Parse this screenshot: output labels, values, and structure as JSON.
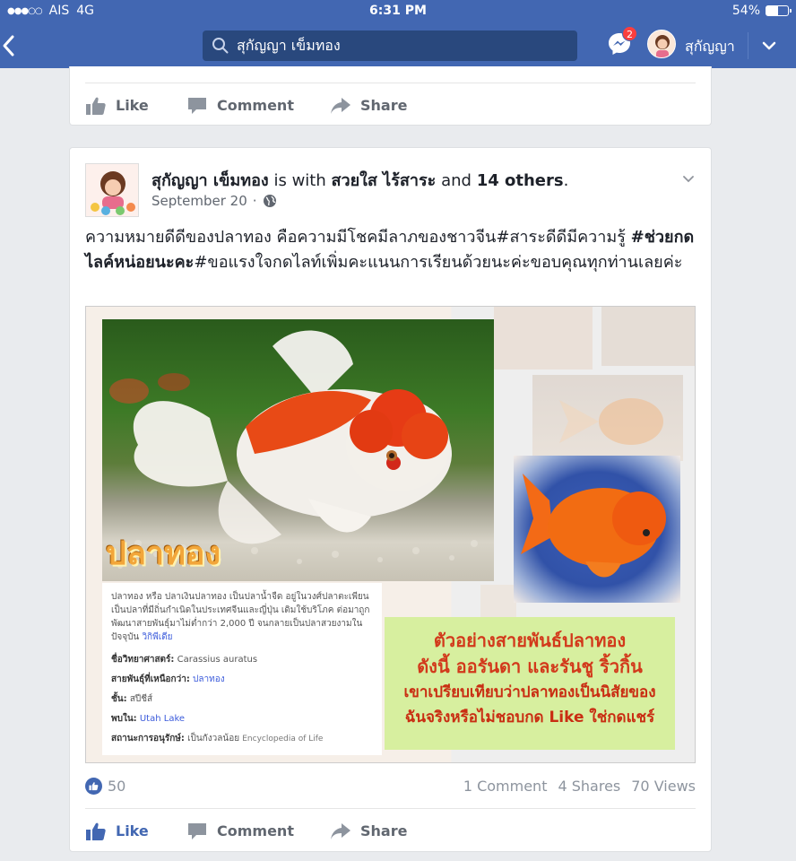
{
  "status_bar": {
    "carrier": "AIS",
    "network": "4G",
    "time": "6:31 PM",
    "battery": "54%",
    "battery_level": 0.54
  },
  "nav": {
    "search_text": "สุกัญญา เข็มทอง",
    "messenger_badge": "2",
    "user_name": "สุกัญญา"
  },
  "top_actions": {
    "like": "Like",
    "comment": "Comment",
    "share": "Share"
  },
  "post": {
    "author": "สุกัญญา เข็มทอง",
    "with_word": "is with",
    "tagged": "สวยใส ไร้สาระ",
    "and_word": "and",
    "others": "14 others",
    "period": ".",
    "date": "September 20",
    "dot": "·",
    "text_part1": "ความหมายดีดีของปลาทอง คือความมีโชคมีลาภของชาวจีน#สาระดีดีมีความรู้ ",
    "text_bold": "#ช่วยกดไลค์หน่อยนะคะ",
    "text_part2": "#ขอแรงใจกดไลท์เพิ่มคะแนนการเรียนด้วยนะค่ะขอบคุณทุกท่านเลยค่ะ",
    "image": {
      "title_overlay": "ปลาทอง",
      "wiki_desc": "ปลาทอง หรือ ปลาเงินปลาทอง เป็นปลาน้ำจืด อยู่ในวงศ์ปลาตะเพียน เป็นปลาที่มีถิ่นกำเนิดในประเทศจีนและญี่ปุ่น เดิมใช้บริโภค ต่อมาถูกพัฒนาสายพันธุ์มาไม่ต่ำกว่า 2,000 ปี จนกลายเป็นปลาสวยงามในปัจจุบัน",
      "wiki_link": "วิกิพีเดีย",
      "rows": [
        {
          "label": "ชื่อวิทยาศาสตร์:",
          "value": "Carassius auratus",
          "link": false
        },
        {
          "label": "สายพันธุ์ที่เหนือกว่า:",
          "value": "ปลาทอง",
          "link": true
        },
        {
          "label": "ชั้น:",
          "value": "สปีชีส์",
          "link": false
        },
        {
          "label": "พบใน:",
          "value": "Utah Lake",
          "link": true
        },
        {
          "label": "สถานะการอนุรักษ์:",
          "value": "เป็นกังวลน้อย",
          "link": false,
          "source": "Encyclopedia of Life"
        }
      ],
      "green_lines": [
        "ตัวอย่างสายพันธ์ปลาทอง",
        "ดังนี้ ออรันดา และรันชู ริ้วกิ้น",
        "เขาเปรียบเทียบว่าปลาทองเป็นนิสัยของ",
        "ฉันจริงหรือไม่ชอบกด Like ใช่กดแชร์"
      ]
    },
    "likes_count": "50",
    "comments": "1 Comment",
    "shares": "4 Shares",
    "views": "70 Views",
    "actions": {
      "like": "Like",
      "comment": "Comment",
      "share": "Share"
    }
  },
  "colors": {
    "brand_blue": "#4267b2",
    "action_grey": "#616770"
  }
}
